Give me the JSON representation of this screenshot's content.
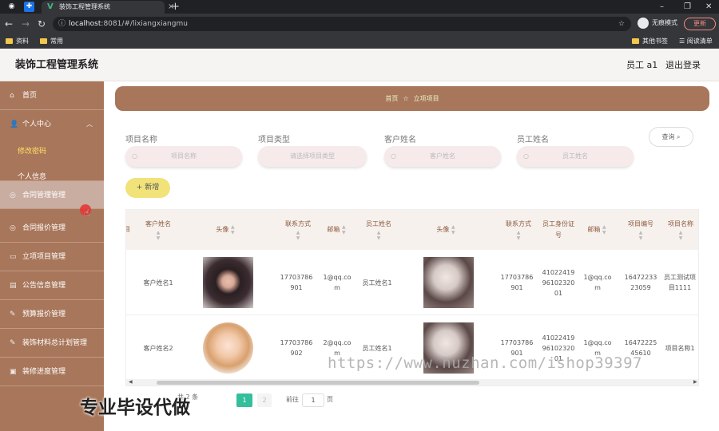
{
  "browser": {
    "tab_title": "装饰工程管理系统",
    "url_host": "localhost",
    "url_rest": ":8081/#/lixiangxiangmu",
    "incognito_label": "无痕模式",
    "update_label": "更新",
    "bookmarks": [
      "资料",
      "常用"
    ],
    "bookmarks_right": [
      "其他书签",
      "阅读清单"
    ]
  },
  "header": {
    "title": "装饰工程管理系统",
    "user": "员工 a1",
    "logout": "退出登录"
  },
  "sidebar": {
    "items": [
      {
        "label": "首页",
        "icon": "home-icon"
      },
      {
        "label": "个人中心",
        "icon": "user-icon"
      },
      {
        "label": "合同管理管理",
        "icon": "contract-icon"
      },
      {
        "label": "合同报价管理",
        "icon": "quote-icon"
      },
      {
        "label": "立项项目管理",
        "icon": "project-icon"
      },
      {
        "label": "公告信息管理",
        "icon": "notice-icon"
      },
      {
        "label": "预算报价管理",
        "icon": "budget-icon"
      },
      {
        "label": "装饰材料总计划管理",
        "icon": "material-icon"
      },
      {
        "label": "装修进度管理",
        "icon": "progress-icon"
      }
    ],
    "subitems": [
      "修改密码",
      "个人信息"
    ]
  },
  "breadcrumb": {
    "home": "首页",
    "current": "立项项目"
  },
  "search": {
    "fields": [
      {
        "label": "项目名称",
        "placeholder": "项目名称"
      },
      {
        "label": "项目类型",
        "placeholder": "请选择项目类型"
      },
      {
        "label": "客户姓名",
        "placeholder": "客户姓名"
      },
      {
        "label": "员工姓名",
        "placeholder": "员工姓名"
      }
    ],
    "query_label": "查询"
  },
  "add_label": "+ 新增",
  "table": {
    "partial_first_col": "目",
    "columns": [
      "客户姓名",
      "头像",
      "联系方式",
      "邮箱",
      "员工姓名",
      "头像",
      "联系方式",
      "员工身份证号",
      "邮箱",
      "项目编号",
      "项目名称"
    ],
    "rows": [
      {
        "customer_name": "客户姓名1",
        "customer_photo": "avatar-woman-dark-hair",
        "customer_phone": "17703786901",
        "customer_email": "1@qq.com",
        "employee_name": "员工姓名1",
        "employee_photo": "photo-woman-portrait",
        "employee_phone": "17703786901",
        "employee_id": "410224199610232001",
        "employee_email": "1@qq.com",
        "project_no": "1647223323059",
        "project_name": "员工测试项目1111"
      },
      {
        "customer_name": "客户姓名2",
        "customer_photo": "avatar-illustrated-girl",
        "customer_phone": "17703786902",
        "customer_email": "2@qq.com",
        "employee_name": "员工姓名1",
        "employee_photo": "photo-woman-portrait",
        "employee_phone": "17703786901",
        "employee_id": "410224199610232001",
        "employee_email": "1@qq.com",
        "project_no": "1647222545610",
        "project_name": "项目名称1"
      }
    ]
  },
  "pagination": {
    "prefix": "共 2 条",
    "current": "1",
    "next": "2",
    "goto_label": "前往",
    "goto_value": "1",
    "page_unit": "页"
  },
  "watermark": "https://www.huzhan.com/ishop39397",
  "overlay_caption": "专业毕设代做",
  "colors": {
    "sidebar": "#a8765a",
    "accent_green": "#34bf9b",
    "add_button": "#f1e27a"
  }
}
